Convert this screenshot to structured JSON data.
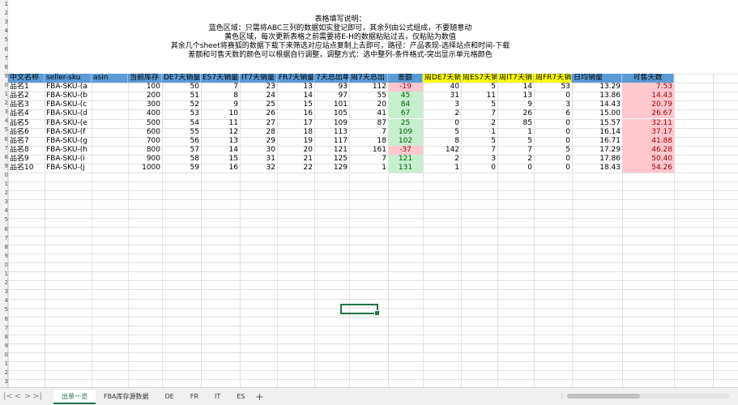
{
  "notes": [
    "表格填写说明：",
    "蓝色区域：只需将ABC三列的数据如实登记即可，其余列由公式组成，不要随意动",
    "黄色区域，每次更新表格之前需要将E-H的数据粘贴过去，仅粘贴为数值",
    "其余几个sheet将赛狐的数据下载下来筛选对应站点复制上去即可，路径：产品表现-选择站点和时间-下载",
    "差额和可售天数的颜色可以根据自行调整，调整方式：选中整列-条件格式-突出显示单元格颜色"
  ],
  "row_numbers": [
    "1",
    "2",
    "3",
    "4",
    "5",
    "6",
    "7",
    "8",
    "9",
    "0",
    "1",
    "2",
    "3",
    "4",
    "5",
    "6",
    "7",
    "8",
    "9",
    "0",
    "1",
    "2",
    "3",
    "4",
    "5",
    "6",
    "7",
    "8",
    "9",
    "0",
    "1",
    "2",
    "3",
    "4",
    "5",
    "6",
    "7",
    "8",
    "9",
    "0",
    "1",
    "2",
    "3"
  ],
  "headers": [
    "中文名称",
    "seller-sku",
    "asin",
    "当前库存",
    "DE7天销量",
    "ES7天销量",
    "IT7天销量",
    "FR7天销量",
    "7天总出单",
    "周7天总出",
    "差额",
    "周DE7天销",
    "周ES7天销",
    "周IT7天销",
    "周FR7天销",
    "日均销量",
    "可售天数"
  ],
  "rows": [
    {
      "name": "品名1",
      "sku": "FBA-SKU-(a",
      "asin": "",
      "stock": "100",
      "de7": "50",
      "es7": "7",
      "it7": "23",
      "fr7": "13",
      "total7": "93",
      "wtotal7": "112",
      "diff": "-19",
      "wde": "40",
      "wes": "5",
      "wit": "14",
      "wfr": "53",
      "daily": "13.29",
      "days": "7.53"
    },
    {
      "name": "品名2",
      "sku": "FBA-SKU-(b",
      "asin": "",
      "stock": "200",
      "de7": "51",
      "es7": "8",
      "it7": "24",
      "fr7": "14",
      "total7": "97",
      "wtotal7": "55",
      "diff": "45",
      "wde": "31",
      "wes": "11",
      "wit": "13",
      "wfr": "0",
      "daily": "13.86",
      "days": "14.43"
    },
    {
      "name": "品名3",
      "sku": "FBA-SKU-(c",
      "asin": "",
      "stock": "300",
      "de7": "52",
      "es7": "9",
      "it7": "25",
      "fr7": "15",
      "total7": "101",
      "wtotal7": "20",
      "diff": "84",
      "wde": "3",
      "wes": "5",
      "wit": "9",
      "wfr": "3",
      "daily": "14.43",
      "days": "20.79"
    },
    {
      "name": "品名4",
      "sku": "FBA-SKU-(d",
      "asin": "",
      "stock": "400",
      "de7": "53",
      "es7": "10",
      "it7": "26",
      "fr7": "16",
      "total7": "105",
      "wtotal7": "41",
      "diff": "67",
      "wde": "2",
      "wes": "7",
      "wit": "26",
      "wfr": "6",
      "daily": "15.00",
      "days": "26.67"
    },
    {
      "name": "品名5",
      "sku": "FBA-SKU-(e",
      "asin": "",
      "stock": "500",
      "de7": "54",
      "es7": "11",
      "it7": "27",
      "fr7": "17",
      "total7": "109",
      "wtotal7": "87",
      "diff": "25",
      "wde": "0",
      "wes": "2",
      "wit": "85",
      "wfr": "0",
      "daily": "15.57",
      "days": "32.11"
    },
    {
      "name": "品名6",
      "sku": "FBA-SKU-(f",
      "asin": "",
      "stock": "600",
      "de7": "55",
      "es7": "12",
      "it7": "28",
      "fr7": "18",
      "total7": "113",
      "wtotal7": "7",
      "diff": "109",
      "wde": "5",
      "wes": "1",
      "wit": "1",
      "wfr": "0",
      "daily": "16.14",
      "days": "37.17"
    },
    {
      "name": "品名7",
      "sku": "FBA-SKU-(g",
      "asin": "",
      "stock": "700",
      "de7": "56",
      "es7": "13",
      "it7": "29",
      "fr7": "19",
      "total7": "117",
      "wtotal7": "18",
      "diff": "102",
      "wde": "8",
      "wes": "5",
      "wit": "5",
      "wfr": "0",
      "daily": "16.71",
      "days": "41.88"
    },
    {
      "name": "品名8",
      "sku": "FBA-SKU-(h",
      "asin": "",
      "stock": "800",
      "de7": "57",
      "es7": "14",
      "it7": "30",
      "fr7": "20",
      "total7": "121",
      "wtotal7": "161",
      "diff": "-37",
      "wde": "142",
      "wes": "7",
      "wit": "7",
      "wfr": "5",
      "daily": "17.29",
      "days": "46.28"
    },
    {
      "name": "品名9",
      "sku": "FBA-SKU-(i",
      "asin": "",
      "stock": "900",
      "de7": "58",
      "es7": "15",
      "it7": "31",
      "fr7": "21",
      "total7": "125",
      "wtotal7": "7",
      "diff": "121",
      "wde": "2",
      "wes": "3",
      "wit": "2",
      "wfr": "0",
      "daily": "17.86",
      "days": "50.40"
    },
    {
      "name": "品名10",
      "sku": "FBA-SKU-(j",
      "asin": "",
      "stock": "1000",
      "de7": "59",
      "es7": "16",
      "it7": "32",
      "fr7": "22",
      "total7": "129",
      "wtotal7": "1",
      "diff": "131",
      "wde": "1",
      "wes": "0",
      "wit": "0",
      "wfr": "0",
      "daily": "18.43",
      "days": "54.26"
    }
  ],
  "tabs": [
    "出单一览",
    "FBA库存源数据",
    "DE",
    "FR",
    "IT",
    "ES"
  ],
  "active_tab": "出单一览",
  "add_tab_label": "+",
  "nav_buttons": [
    "|<",
    "<",
    ">",
    ">|"
  ],
  "colors": {
    "blue_header": "#5b9bd5",
    "yellow_header": "#ffff00",
    "negative_bg": "#ffc7ce",
    "positive_bg": "#c6efce",
    "selection": "#217346"
  }
}
